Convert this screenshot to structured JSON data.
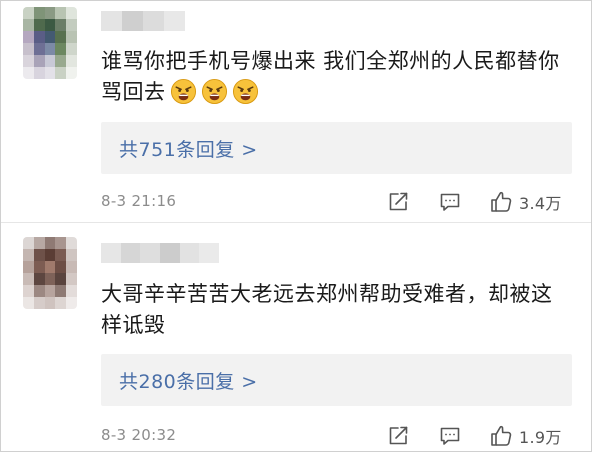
{
  "comments": [
    {
      "text": "谁骂你把手机号爆出来 我们全郑州的人民都替你骂回去",
      "emoji_icon": "angry-face-emoji",
      "emoji_count": 3,
      "replies_label": "共751条回复 >",
      "time": "8-3 21:16",
      "likes": "3.4万"
    },
    {
      "text": "大哥辛辛苦苦大老远去郑州帮助受难者，却被这样诋毁",
      "replies_label": "共280条回复 >",
      "time": "8-3 20:32",
      "likes": "1.9万"
    }
  ],
  "colors": {
    "reply_link": "#4a6fa8",
    "reply_bg": "#f2f2f2",
    "meta_text": "#8c8c8c",
    "icon": "#555555"
  },
  "icons": [
    "share-icon",
    "comment-icon",
    "like-icon"
  ]
}
